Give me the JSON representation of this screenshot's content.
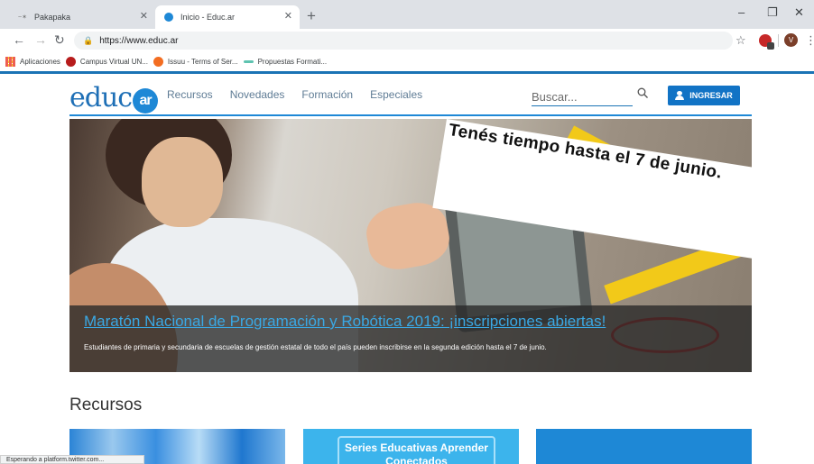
{
  "browser": {
    "tabs": [
      {
        "title": "Pakapaka",
        "favicon": "pakapaka-icon"
      },
      {
        "title": "Inicio - Educ.ar",
        "favicon": "educar-icon"
      }
    ],
    "url": "https://www.educ.ar",
    "bookmarks": [
      {
        "label": "Aplicaciones",
        "icon": "apps-icon",
        "color": "#ea4335"
      },
      {
        "label": "Campus Virtual UN...",
        "icon": "campus-icon",
        "color": "#b71c1c"
      },
      {
        "label": "Issuu - Terms of Ser...",
        "icon": "issuu-icon",
        "color": "#f36d21"
      },
      {
        "label": "Propuestas Formati...",
        "icon": "propuestas-icon",
        "color": "#5ec3b0"
      }
    ],
    "avatar_letter": "V",
    "status_text": "Esperando a platform.twitter.com..."
  },
  "site": {
    "logo_text": "educ",
    "logo_badge": "ar",
    "menu": [
      "Recursos",
      "Novedades",
      "Formación",
      "Especiales"
    ],
    "search_placeholder": "Buscar...",
    "login_label": "INGRESAR",
    "accent_color": "#1e88d6"
  },
  "hero": {
    "banner_text": "Tenés tiempo hasta el 7 de junio.",
    "title": "Maratón Nacional de Programación y Robótica 2019: ¡inscripciones abiertas!",
    "description": "Estudiantes de primaria y secundaria de escuelas de gestión estatal de todo el país pueden inscribirse en la segunda edición hasta el 7 de junio."
  },
  "resources": {
    "section_title": "Recursos",
    "cards": [
      {
        "label": ""
      },
      {
        "label": "Series Educativas Aprender Conectados"
      },
      {
        "label": ""
      }
    ]
  }
}
